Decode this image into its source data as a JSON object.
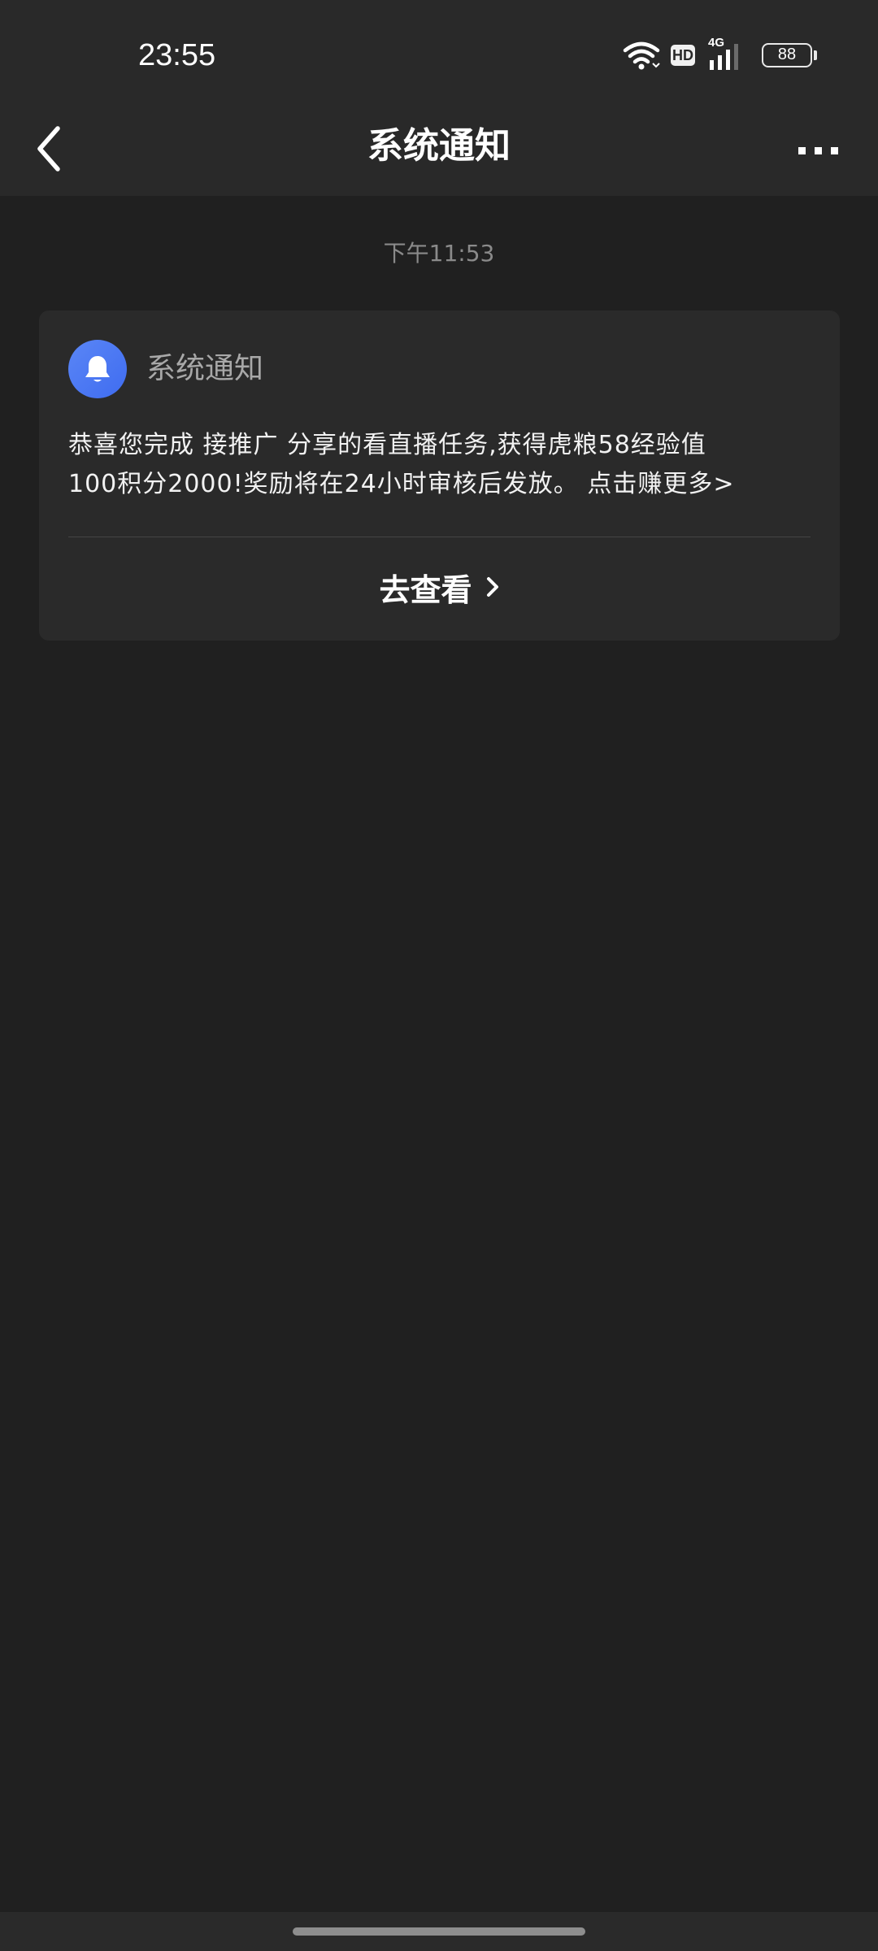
{
  "status_bar": {
    "time": "23:55",
    "network_badge": "HD",
    "signal_label": "4G",
    "battery_level": "88",
    "icons": [
      "wifi-icon",
      "hd-icon",
      "signal-icon",
      "battery-icon"
    ]
  },
  "header": {
    "title": "系统通知",
    "back_icon": "chevron-left-icon",
    "more_icon": "more-dots-icon"
  },
  "messages": [
    {
      "time": "下午11:53",
      "sender": "系统通知",
      "avatar_icon": "bell-icon",
      "avatar_color": "#4a78f3",
      "body": "恭喜您完成 接推广 分享的看直播任务,获得虎粮58经验值\n100积分2000!奖励将在24小时审核后发放。 点击赚更多>",
      "action_label": "去查看",
      "action_icon": "chevron-right-icon"
    }
  ]
}
